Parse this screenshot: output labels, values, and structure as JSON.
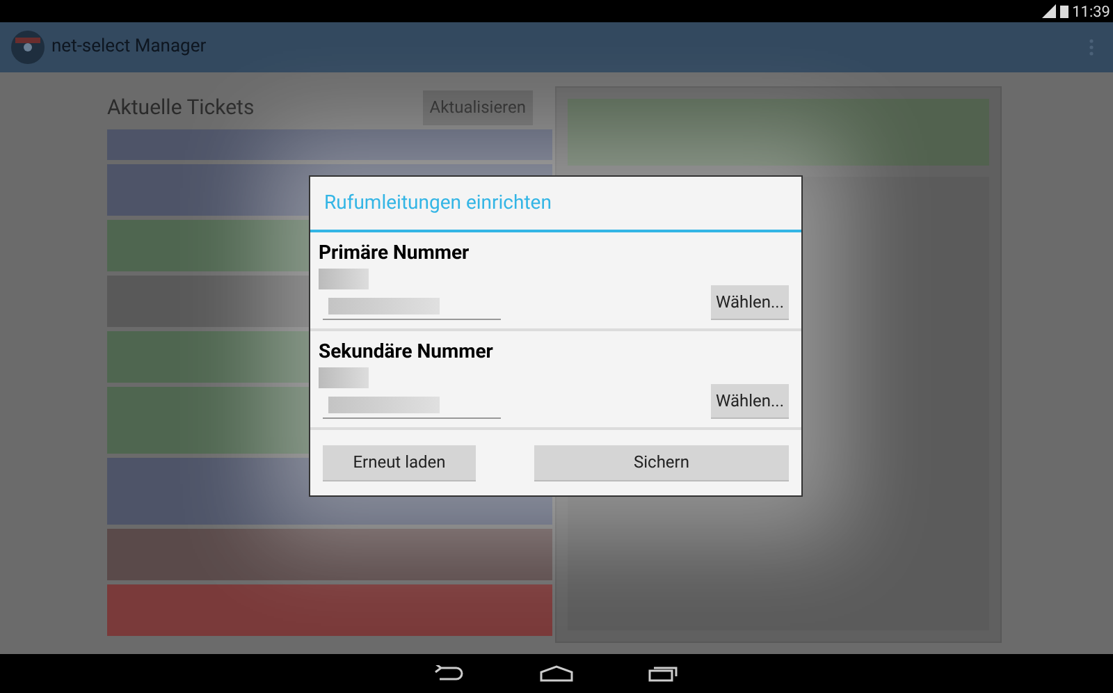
{
  "status_bar": {
    "time": "11:39"
  },
  "action_bar": {
    "title": "net-select Manager"
  },
  "tickets": {
    "title": "Aktuelle Tickets",
    "refresh_button": "Aktualisieren",
    "rows": [
      {
        "color": "#4e5468"
      },
      {
        "color": "#4e5468"
      },
      {
        "color": "#4f6650"
      },
      {
        "color": "#595959"
      },
      {
        "color": "#4f6650"
      },
      {
        "color": "#4f6650"
      },
      {
        "color": "#4e5468"
      },
      {
        "color": "#5a4a4a"
      },
      {
        "color": "#7a3a3a"
      }
    ]
  },
  "dialog": {
    "title": "Rufumleitungen einrichten",
    "sections": [
      {
        "heading": "Primäre Nummer",
        "button": "Wählen..."
      },
      {
        "heading": "Sekundäre Nummer",
        "button": "Wählen..."
      }
    ],
    "buttons": [
      "Erneut laden",
      "Sichern"
    ]
  }
}
